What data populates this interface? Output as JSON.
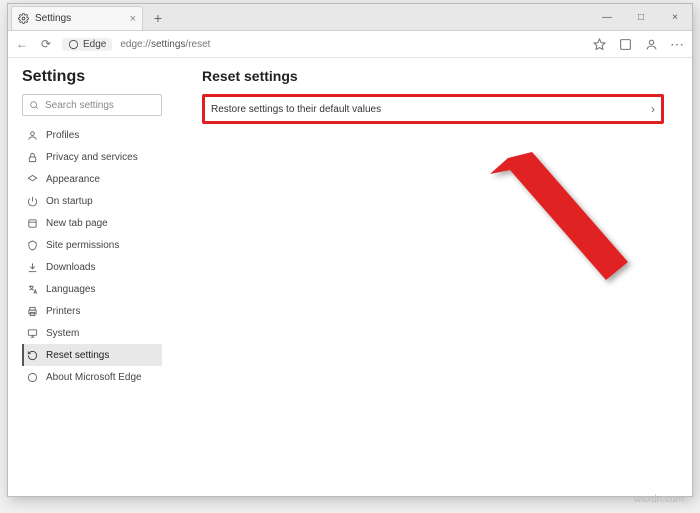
{
  "tab": {
    "title": "Settings",
    "close": "×"
  },
  "window_controls": {
    "minimize": "—",
    "maximize": "□",
    "close": "×"
  },
  "addrbar": {
    "back": "←",
    "refresh": "⟳",
    "chip_label": "Edge",
    "url_prefix": "edge://",
    "url_path1": "settings",
    "url_path2": "/reset"
  },
  "sidebar": {
    "title": "Settings",
    "search_placeholder": "Search settings",
    "items": [
      {
        "label": "Profiles"
      },
      {
        "label": "Privacy and services"
      },
      {
        "label": "Appearance"
      },
      {
        "label": "On startup"
      },
      {
        "label": "New tab page"
      },
      {
        "label": "Site permissions"
      },
      {
        "label": "Downloads"
      },
      {
        "label": "Languages"
      },
      {
        "label": "Printers"
      },
      {
        "label": "System"
      },
      {
        "label": "Reset settings"
      },
      {
        "label": "About Microsoft Edge"
      }
    ]
  },
  "main": {
    "heading": "Reset settings",
    "row_label": "Restore settings to their default values",
    "chevron": "›"
  },
  "watermark": "wsxdn.com"
}
